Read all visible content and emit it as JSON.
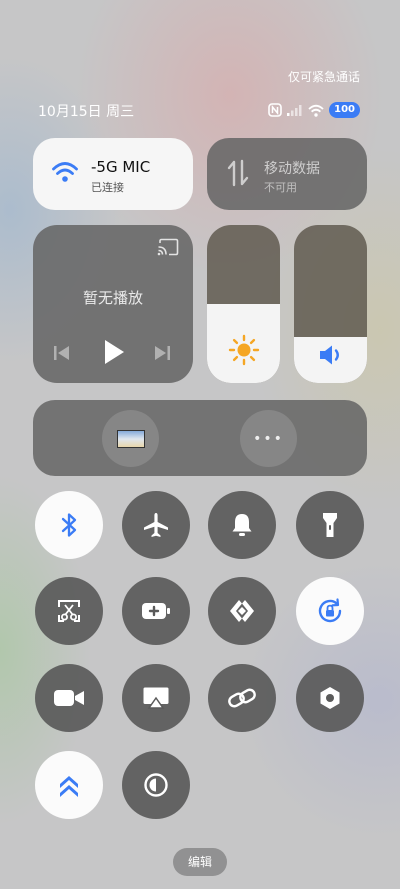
{
  "status_bar": {
    "emergency_text": "仅可紧急通话",
    "date": "10月15日 周三",
    "battery": "100",
    "icons": [
      "nfc-icon",
      "signal-icon",
      "wifi-icon",
      "battery-icon"
    ]
  },
  "wifi": {
    "name": "-5G      MIC",
    "status": "已连接",
    "active": true
  },
  "mobile_data": {
    "name": "移动数据",
    "status": "不可用",
    "active": false
  },
  "media": {
    "title": "暂无播放"
  },
  "brightness": {
    "level_percent": 50
  },
  "volume": {
    "level_percent": 29
  },
  "toggles": [
    {
      "icon": "bluetooth-icon",
      "active": true
    },
    {
      "icon": "airplane-icon",
      "active": false
    },
    {
      "icon": "bell-icon",
      "active": false
    },
    {
      "icon": "flashlight-icon",
      "active": false
    },
    {
      "icon": "screenshot-icon",
      "active": false
    },
    {
      "icon": "battery-saver-icon",
      "active": false
    },
    {
      "icon": "nearby-share-icon",
      "active": false
    },
    {
      "icon": "rotation-lock-icon",
      "active": true
    },
    {
      "icon": "screen-record-icon",
      "active": false
    },
    {
      "icon": "screen-cast-icon",
      "active": false
    },
    {
      "icon": "link-icon",
      "active": false
    },
    {
      "icon": "settings-hex-icon",
      "active": false
    },
    {
      "icon": "double-chevron-up-icon",
      "active": true
    },
    {
      "icon": "dark-mode-icon",
      "active": false
    }
  ],
  "edit_label": "编辑",
  "colors": {
    "accent": "#3b7cf5",
    "sun": "#f5a623"
  }
}
